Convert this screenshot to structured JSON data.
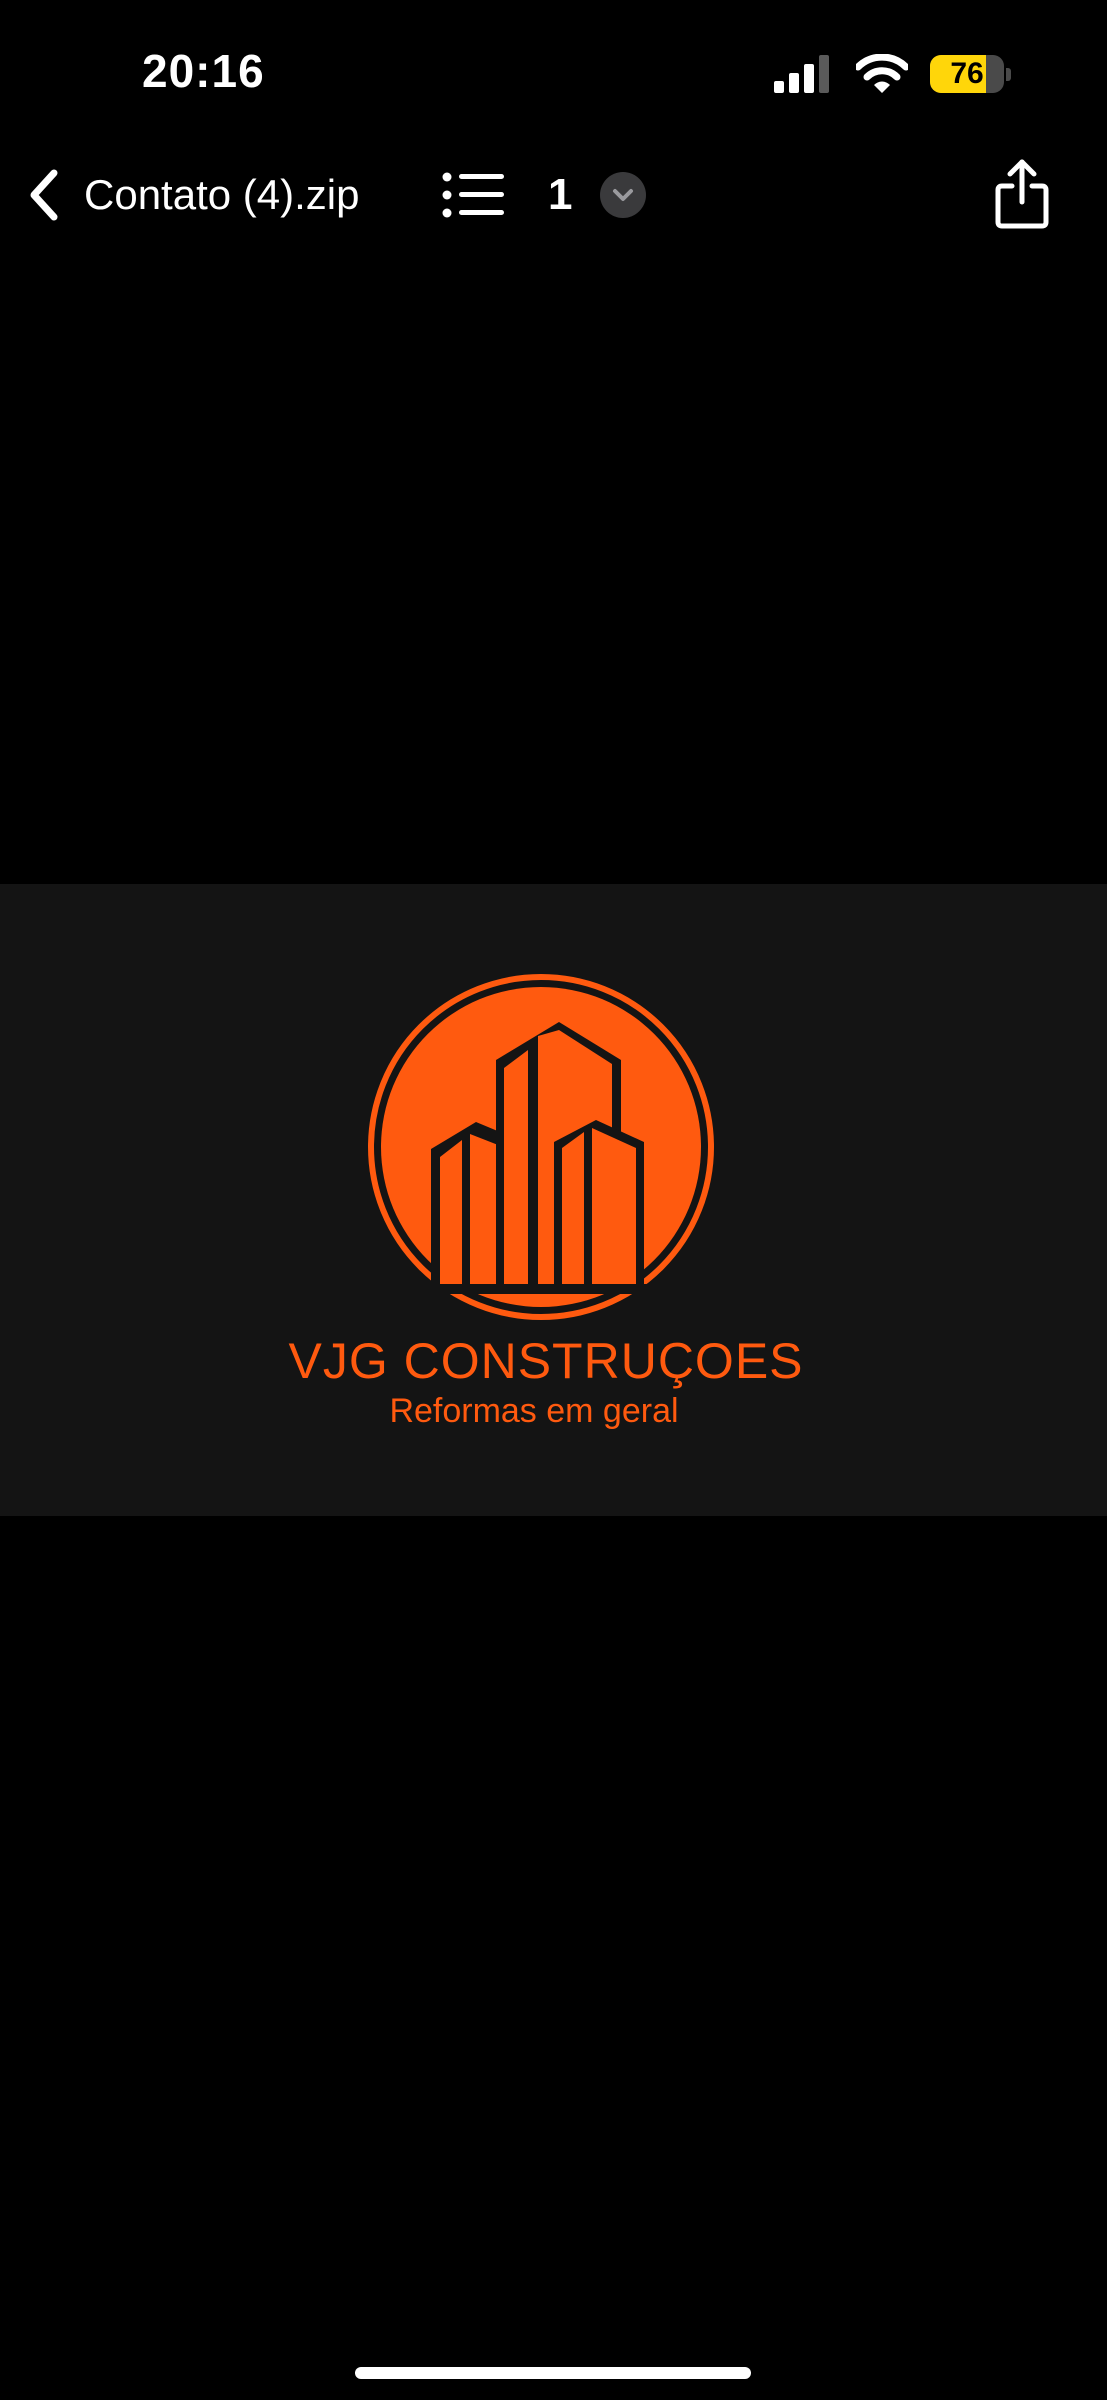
{
  "status_bar": {
    "time": "20:16",
    "battery_level": "76",
    "battery_fraction": 0.76,
    "battery_color": "#ffd60a",
    "icons": [
      "signal-icon",
      "wifi-icon",
      "battery-icon"
    ]
  },
  "nav_bar": {
    "title": "Contato (4).zip",
    "page_number": "1",
    "icons": [
      "chevron-left-icon",
      "list-icon",
      "chevron-down-icon",
      "share-icon"
    ]
  },
  "document": {
    "brand_name": "VJG CONSTRUÇOES",
    "tagline": "Reformas em geral",
    "accent_color": "#ff5a0f",
    "background_color": "#141414"
  }
}
